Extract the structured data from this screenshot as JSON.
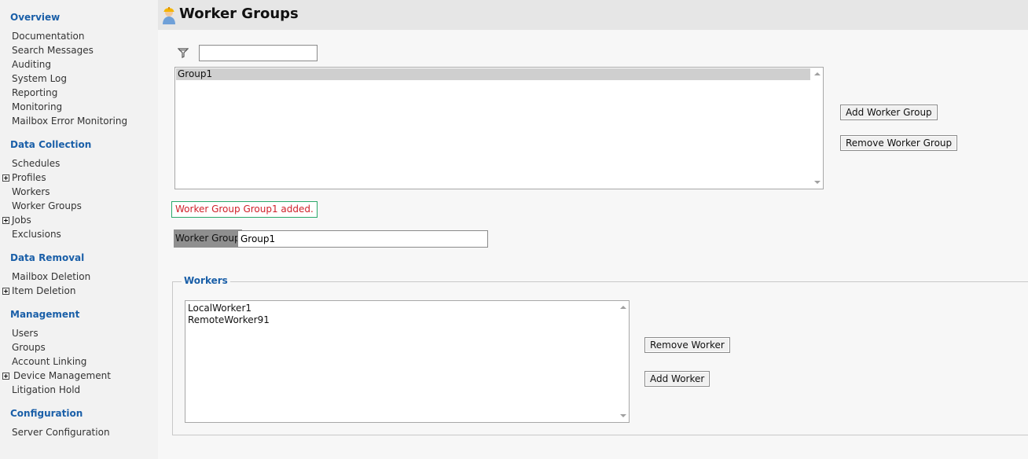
{
  "sidebar": {
    "sections": [
      {
        "title": "Overview",
        "items": [
          {
            "label": "Documentation",
            "expandable": false
          },
          {
            "label": "Search Messages",
            "expandable": false
          },
          {
            "label": "Auditing",
            "expandable": false
          },
          {
            "label": "System Log",
            "expandable": false
          },
          {
            "label": "Reporting",
            "expandable": false
          },
          {
            "label": "Monitoring",
            "expandable": false
          },
          {
            "label": "Mailbox Error Monitoring",
            "expandable": false
          }
        ]
      },
      {
        "title": "Data Collection",
        "items": [
          {
            "label": "Schedules",
            "expandable": false
          },
          {
            "label": "Profiles",
            "expandable": true
          },
          {
            "label": "Workers",
            "expandable": false
          },
          {
            "label": "Worker Groups",
            "expandable": false
          },
          {
            "label": "Jobs",
            "expandable": true
          },
          {
            "label": "Exclusions",
            "expandable": false
          }
        ]
      },
      {
        "title": "Data Removal",
        "items": [
          {
            "label": "Mailbox Deletion",
            "expandable": false
          },
          {
            "label": "Item Deletion",
            "expandable": true
          }
        ]
      },
      {
        "title": "Management",
        "items": [
          {
            "label": "Users",
            "expandable": false
          },
          {
            "label": "Groups",
            "expandable": false
          },
          {
            "label": "Account Linking",
            "expandable": false
          },
          {
            "label": "Device Management",
            "expandable": true
          },
          {
            "label": "Litigation Hold",
            "expandable": false
          }
        ]
      },
      {
        "title": "Configuration",
        "items": [
          {
            "label": "Server Configuration",
            "expandable": false
          }
        ]
      }
    ]
  },
  "header": {
    "title": "Worker Groups",
    "icon": "worker-person-icon"
  },
  "filter": {
    "icon": "funnel-filter-icon",
    "value": ""
  },
  "groups_list": {
    "items": [
      "Group1"
    ],
    "selected_index": 0
  },
  "group_buttons": {
    "add_label": "Add Worker Group",
    "remove_label": "Remove Worker Group"
  },
  "status": {
    "message": "Worker Group Group1 added.",
    "text_color": "#d0202a",
    "border_color": "#2aa86a"
  },
  "worker_group_field": {
    "label": "Worker Group",
    "value": "Group1"
  },
  "workers": {
    "legend": "Workers",
    "items": [
      "LocalWorker1",
      "RemoteWorker91"
    ],
    "remove_label": "Remove Worker",
    "add_label": "Add Worker"
  },
  "colors": {
    "accent": "#1a5fa8",
    "sidebar_bg": "#f2f2f2",
    "header_bg": "#e6e6e6"
  }
}
